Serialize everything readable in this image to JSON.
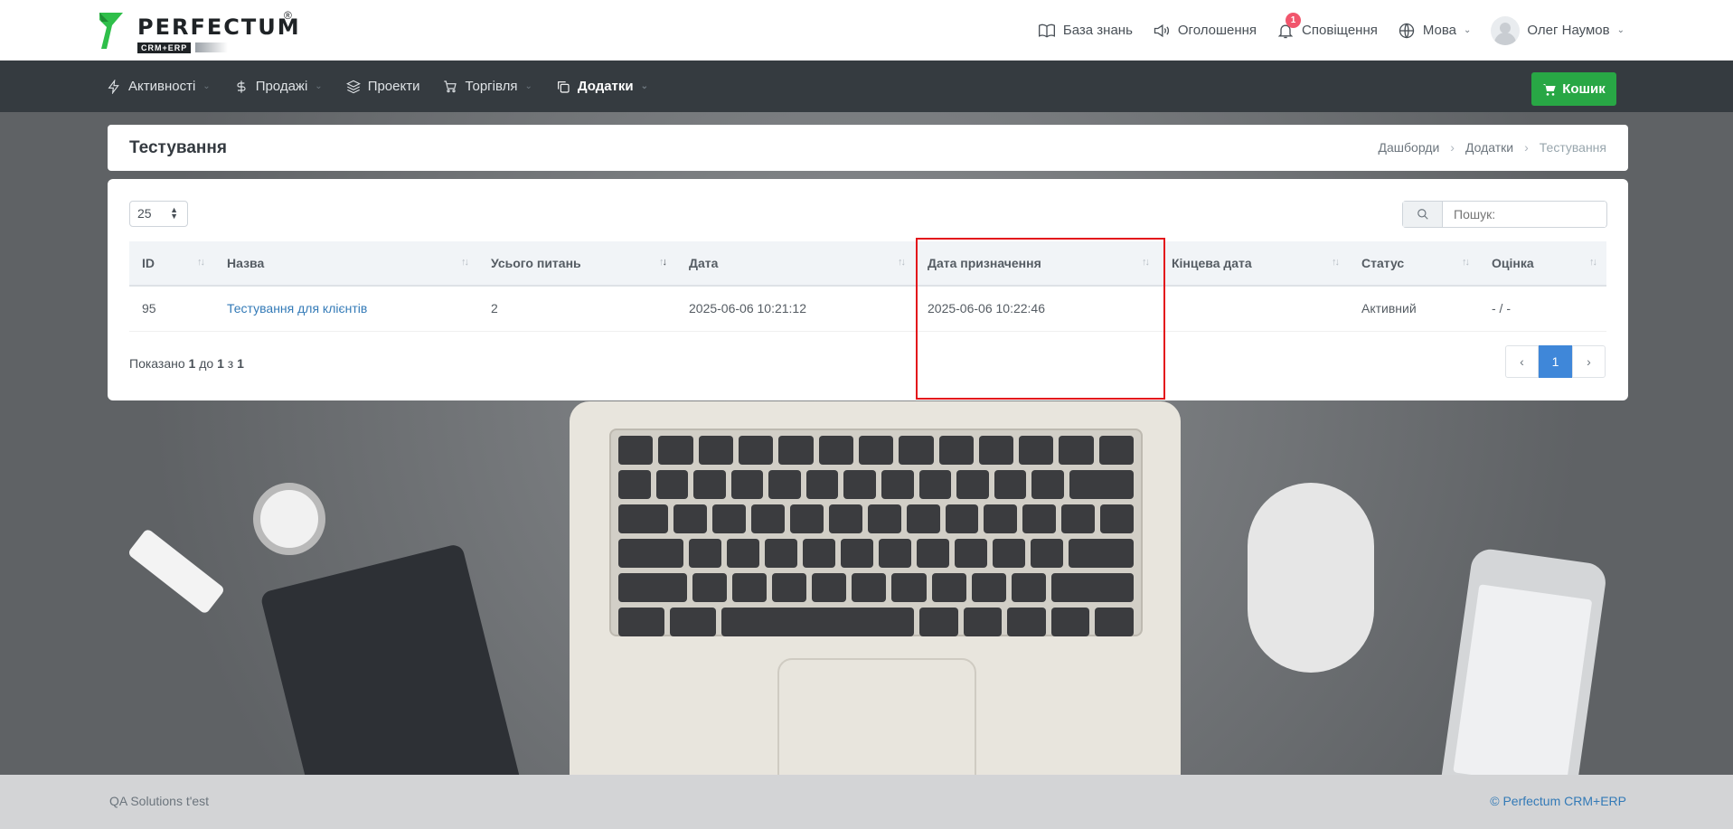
{
  "brand": {
    "name": "PERFECTUM",
    "reg": "®",
    "sub": "CRM+ERP"
  },
  "topnav": {
    "knowledge": "База знань",
    "announcements": "Оголошення",
    "notifications": "Сповіщення",
    "notifications_count": "1",
    "language": "Мова",
    "user": "Олег Наумов"
  },
  "menu": {
    "activities": "Активності",
    "sales": "Продажі",
    "projects": "Проекти",
    "trade": "Торгівля",
    "addons": "Додатки",
    "cart": "Кошик"
  },
  "page": {
    "title": "Тестування",
    "breadcrumb": [
      "Дашборди",
      "Додатки",
      "Тестування"
    ]
  },
  "table": {
    "per_page": "25",
    "search_placeholder": "Пошук:",
    "columns": [
      "ID",
      "Назва",
      "Усього питань",
      "Дата",
      "Дата призначення",
      "Кінцева дата",
      "Статус",
      "Оцінка"
    ],
    "rows": [
      {
        "id": "95",
        "name": "Тестування для клієнтів",
        "total": "2",
        "date": "2025-06-06 10:21:12",
        "assigned": "2025-06-06 10:22:46",
        "end": "",
        "status": "Активний",
        "score": "- / -"
      }
    ],
    "shown_prefix": "Показано",
    "shown_from": "1",
    "shown_to_word": "до",
    "shown_to": "1",
    "shown_of_word": "з",
    "shown_total": "1",
    "page": "1"
  },
  "footer": {
    "left": "QA Solutions t'est",
    "right": "© Perfectum CRM+ERP"
  },
  "colors": {
    "accent": "#3f87d9",
    "cart": "#28a745",
    "nav": "#353b40",
    "highlight": "#e3141b"
  }
}
